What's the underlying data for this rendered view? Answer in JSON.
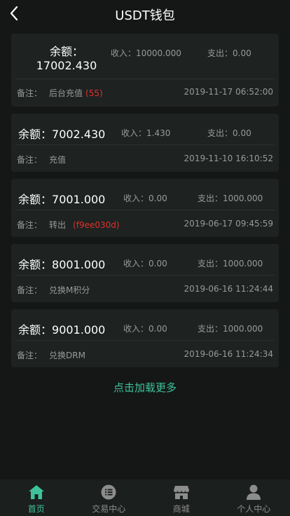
{
  "header": {
    "title": "USDT钱包"
  },
  "records": [
    {
      "balance_label": "余额：",
      "balance": "17002.430",
      "income": "收入：10000.000",
      "expense": "支出：0.00",
      "remark_label": "备注：",
      "remark": "后台充值",
      "remark_extra": "(55)",
      "time": "2019-11-17 06:52:00"
    },
    {
      "balance_label": "余额：",
      "balance": "7002.430",
      "income": "收入：1.430",
      "expense": "支出：0.00",
      "remark_label": "备注：",
      "remark": "充值",
      "remark_extra": "",
      "time": "2019-11-10 16:10:52"
    },
    {
      "balance_label": "余额：",
      "balance": "7001.000",
      "income": "收入：0.00",
      "expense": "支出：1000.000",
      "remark_label": "备注：",
      "remark": "转出",
      "remark_extra": "(f9ee030d)",
      "time": "2019-06-17 09:45:59"
    },
    {
      "balance_label": "余额：",
      "balance": "8001.000",
      "income": "收入：0.00",
      "expense": "支出：1000.000",
      "remark_label": "备注：",
      "remark": "兑换M积分",
      "remark_extra": "",
      "time": "2019-06-16 11:24:44"
    },
    {
      "balance_label": "余额：",
      "balance": "9001.000",
      "income": "收入：0.00",
      "expense": "支出：1000.000",
      "remark_label": "备注：",
      "remark": "兑换DRM",
      "remark_extra": "",
      "time": "2019-06-16 11:24:34"
    }
  ],
  "load_more": "点击加载更多",
  "tabs": [
    {
      "label": "首页",
      "icon": "home-icon",
      "active": true
    },
    {
      "label": "交易中心",
      "icon": "list-icon",
      "active": false
    },
    {
      "label": "商城",
      "icon": "store-icon",
      "active": false
    },
    {
      "label": "个人中心",
      "icon": "user-icon",
      "active": false
    }
  ],
  "colors": {
    "accent": "#3fc19a",
    "alert": "#e0322c",
    "background": "#141716",
    "card": "#1e2221"
  }
}
